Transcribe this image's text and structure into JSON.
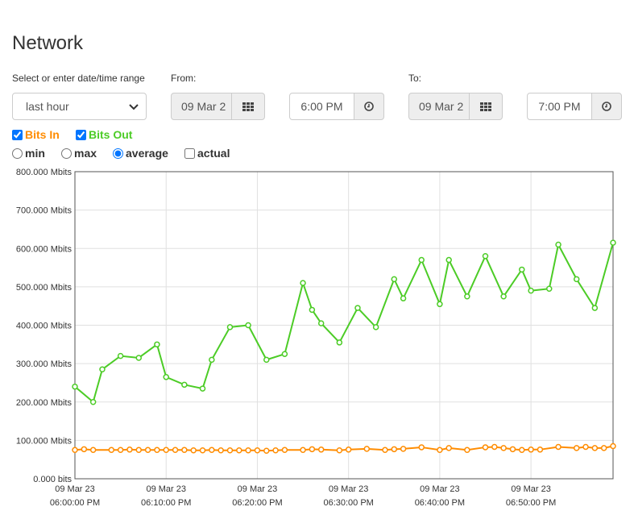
{
  "page": {
    "title": "Network"
  },
  "range": {
    "label": "Select or enter date/time range",
    "value": "last hour"
  },
  "from": {
    "label": "From:",
    "date": "09 Mar 2",
    "time": "6:00 PM"
  },
  "to": {
    "label": "To:",
    "date": "09 Mar 2",
    "time": "7:00 PM"
  },
  "series_toggles": {
    "bits_in": {
      "label": "Bits In",
      "checked": true,
      "color": "#ff8c00"
    },
    "bits_out": {
      "label": "Bits Out",
      "checked": true,
      "color": "#4ccc26"
    }
  },
  "aggregation": {
    "min": {
      "label": "min",
      "selected": false
    },
    "max": {
      "label": "max",
      "selected": false
    },
    "average": {
      "label": "average",
      "selected": true
    },
    "actual": {
      "label": "actual",
      "checked": false
    }
  },
  "icons": {
    "calendar": "calendar-grid-icon",
    "clock": "clock-icon",
    "dropdown": "chevron-down-icon"
  },
  "chart_data": {
    "type": "line",
    "title": "",
    "xlabel": "",
    "ylabel": "",
    "ylim": [
      0,
      800
    ],
    "y_unit": "Mbits",
    "y_ticks": [
      0,
      100,
      200,
      300,
      400,
      500,
      600,
      700,
      800
    ],
    "y_tick_labels": [
      "0.000 bits",
      "100.000 Mbits",
      "200.000 Mbits",
      "300.000 Mbits",
      "400.000 Mbits",
      "500.000 Mbits",
      "600.000 Mbits",
      "700.000 Mbits",
      "800.000 Mbits"
    ],
    "xlim": [
      0,
      59
    ],
    "x_ticks": [
      10,
      20,
      30,
      40,
      50
    ],
    "x_tick_labels": [
      [
        "09 Mar 23",
        "06:00:00 PM"
      ],
      [
        "09 Mar 23",
        "06:10:00 PM"
      ],
      [
        "09 Mar 23",
        "06:20:00 PM"
      ],
      [
        "09 Mar 23",
        "06:30:00 PM"
      ],
      [
        "09 Mar 23",
        "06:40:00 PM"
      ],
      [
        "09 Mar 23",
        "06:50:00 PM"
      ]
    ],
    "grid": true,
    "series": [
      {
        "name": "Bits Out",
        "color": "#4ccc26",
        "x": [
          0,
          2,
          3,
          5,
          7,
          9,
          10,
          12,
          14,
          15,
          17,
          19,
          21,
          23,
          25,
          26,
          27,
          29,
          31,
          33,
          35,
          36,
          38,
          40,
          41,
          43,
          45,
          47,
          49,
          50,
          52,
          53,
          55,
          57,
          59
        ],
        "values": [
          240,
          200,
          285,
          320,
          315,
          350,
          265,
          245,
          235,
          310,
          395,
          400,
          310,
          325,
          510,
          440,
          405,
          355,
          445,
          395,
          520,
          470,
          570,
          455,
          570,
          475,
          580,
          475,
          545,
          490,
          495,
          610,
          520,
          445,
          615
        ]
      },
      {
        "name": "Bits In",
        "color": "#ff8c00",
        "x": [
          0,
          1,
          2,
          4,
          5,
          6,
          7,
          8,
          9,
          10,
          11,
          12,
          13,
          14,
          15,
          16,
          17,
          18,
          19,
          20,
          21,
          22,
          23,
          25,
          26,
          27,
          29,
          30,
          32,
          34,
          35,
          36,
          38,
          40,
          41,
          43,
          45,
          46,
          47,
          48,
          49,
          50,
          51,
          53,
          55,
          56,
          57,
          58,
          59
        ],
        "values": [
          75,
          77,
          75,
          75,
          75,
          76,
          75,
          75,
          75,
          75,
          75,
          75,
          74,
          74,
          75,
          74,
          74,
          74,
          74,
          74,
          73,
          74,
          75,
          75,
          77,
          76,
          74,
          76,
          78,
          75,
          77,
          78,
          82,
          75,
          80,
          75,
          82,
          83,
          80,
          77,
          75,
          76,
          76,
          83,
          80,
          83,
          80,
          80,
          85
        ]
      }
    ]
  }
}
